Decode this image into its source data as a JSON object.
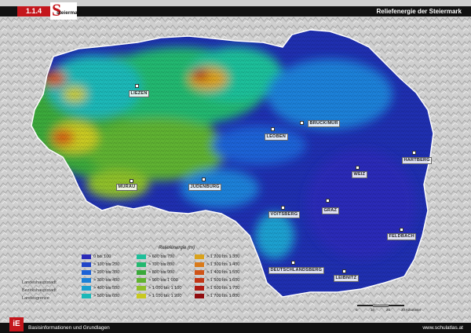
{
  "header": {
    "chapter": "1.1.4",
    "logo_letter": "S",
    "logo_text": "steiermark",
    "title": "Reliefenergie der Steiermark"
  },
  "places": [
    {
      "name": "LIEZEN"
    },
    {
      "name": "LEOBEN"
    },
    {
      "name": "BRUCK/MUR"
    },
    {
      "name": "HARTBERG"
    },
    {
      "name": "MURAU"
    },
    {
      "name": "JUDENBURG"
    },
    {
      "name": "WEIZ"
    },
    {
      "name": "VOITSBERG"
    },
    {
      "name": "GRAZ"
    },
    {
      "name": "FELDBACH"
    },
    {
      "name": "DEUTSCHLANDSBERG"
    },
    {
      "name": "LEIBNITZ"
    }
  ],
  "legend": {
    "title": "Reliefenergie (m)",
    "items": [
      {
        "label": "0 bis 100",
        "color": "#2a2ab8"
      },
      {
        "label": "> 100 bis 200",
        "color": "#1f44c8"
      },
      {
        "label": "> 200 bis 300",
        "color": "#1d62d6"
      },
      {
        "label": "> 300 bis 400",
        "color": "#1b80d8"
      },
      {
        "label": "> 400 bis 500",
        "color": "#1aa0d0"
      },
      {
        "label": "> 500 bis 600",
        "color": "#1ab8b8"
      },
      {
        "label": "> 600 bis 700",
        "color": "#1ebf9a"
      },
      {
        "label": "> 700 bis 800",
        "color": "#22b86f"
      },
      {
        "label": "> 800 bis 900",
        "color": "#3aa93a"
      },
      {
        "label": "> 900 bis 1 000",
        "color": "#5fb230"
      },
      {
        "label": "> 1 000 bis 1 100",
        "color": "#8fbf2a"
      },
      {
        "label": "> 1 100 bis 1 200",
        "color": "#c9c920"
      },
      {
        "label": "> 1 200 bis 1 300",
        "color": "#d9a21c"
      },
      {
        "label": "> 1 300 bis 1 400",
        "color": "#d97a1a"
      },
      {
        "label": "> 1 400 bis 1 500",
        "color": "#cf5418"
      },
      {
        "label": "> 1 500 bis 1 600",
        "color": "#c23616"
      },
      {
        "label": "> 1 600 bis 1 700",
        "color": "#b01c14"
      },
      {
        "label": "> 1 700 bis 1 800",
        "color": "#900c10"
      }
    ]
  },
  "notes": [
    "Landeshauptstadt",
    "Bezirkshauptstadt",
    "Landesgrenze"
  ],
  "scale": {
    "ticks": [
      "0",
      "10",
      "20",
      "30 Kilometer"
    ]
  },
  "footer": {
    "left": "Basisinformationen und Grundlagen",
    "right": "www.schulatlas.at"
  }
}
